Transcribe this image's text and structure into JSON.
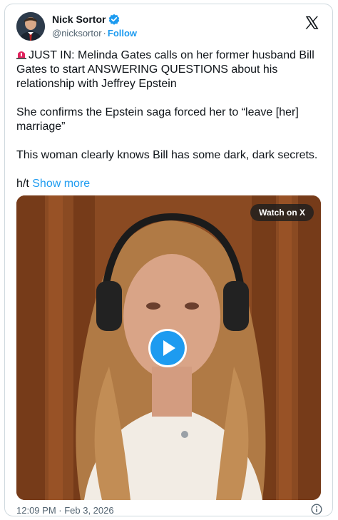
{
  "author": {
    "name": "Nick Sortor",
    "handle": "@nicksortor",
    "follow_label": "Follow"
  },
  "post": {
    "lead": "JUST IN: Melinda Gates calls on her former husband Bill Gates to start ANSWERING QUESTIONS about his relationship with Jeffrey Epstein",
    "para2": "She confirms the Epstein saga forced her to “leave [her] marriage”",
    "para3": "This woman clearly knows Bill has some dark, dark secrets.",
    "ht_prefix": "h/t",
    "show_more_label": "Show more"
  },
  "media": {
    "watch_label": "Watch on X"
  },
  "footer": {
    "timestamp": "12:09 PM · Feb 3, 2026"
  },
  "icons": {
    "verified": "verified-badge-icon",
    "x_logo": "x-logo-icon",
    "siren": "siren-icon",
    "play": "play-icon",
    "info": "info-icon"
  },
  "colors": {
    "accent": "#1d9bf0",
    "text": "#0f1419",
    "muted": "#536471"
  }
}
